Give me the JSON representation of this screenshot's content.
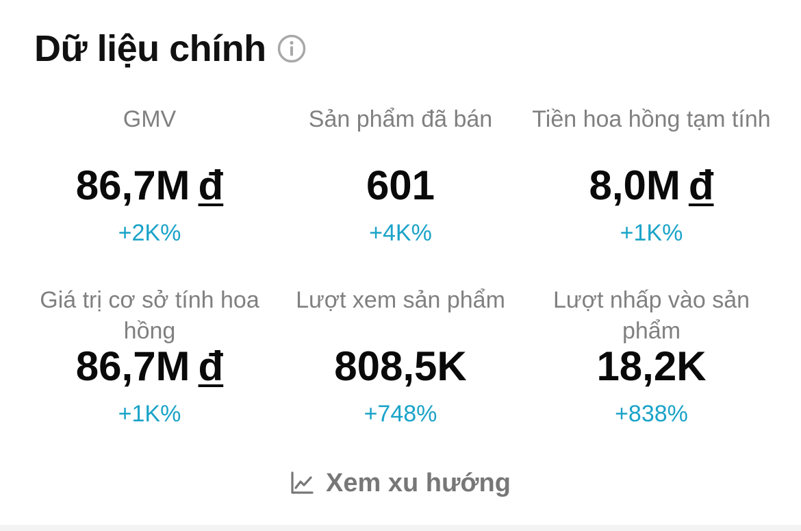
{
  "header": {
    "title": "Dữ liệu chính",
    "info_icon": "info-circle-icon"
  },
  "metrics": [
    {
      "label": "GMV",
      "value": "86,7M",
      "currency": "đ",
      "change": "+2K%"
    },
    {
      "label": "Sản phẩm đã bán",
      "value": "601",
      "currency": "",
      "change": "+4K%"
    },
    {
      "label": "Tiền hoa hồng tạm tính",
      "value": "8,0M",
      "currency": "đ",
      "change": "+1K%"
    },
    {
      "label": "Giá trị cơ sở tính hoa hồng",
      "value": "86,7M",
      "currency": "đ",
      "change": "+1K%"
    },
    {
      "label": "Lượt xem sản phẩm",
      "value": "808,5K",
      "currency": "",
      "change": "+748%"
    },
    {
      "label": "Lượt nhấp vào sản phẩm",
      "value": "18,2K",
      "currency": "",
      "change": "+838%"
    }
  ],
  "trend": {
    "label": "Xem xu hướng",
    "icon": "line-chart-icon"
  },
  "colors": {
    "title": "#111111",
    "label": "#808080",
    "value": "#0a0a0a",
    "change": "#1aa3c8",
    "trend": "#777777"
  }
}
